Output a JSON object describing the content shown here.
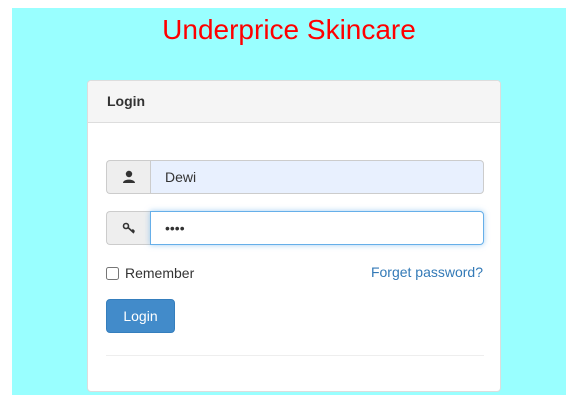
{
  "site": {
    "title": "Underprice Skincare"
  },
  "login_panel": {
    "heading": "Login",
    "username": {
      "value": "Dewi",
      "icon": "user-icon"
    },
    "password": {
      "value": "....",
      "icon": "key-icon"
    },
    "remember_label": "Remember",
    "remember_checked": false,
    "forget_link": "Forget password?",
    "login_button": "Login"
  },
  "colors": {
    "background": "#99ffff",
    "title": "#ff0000",
    "button": "#428bca",
    "link": "#337ab7"
  }
}
